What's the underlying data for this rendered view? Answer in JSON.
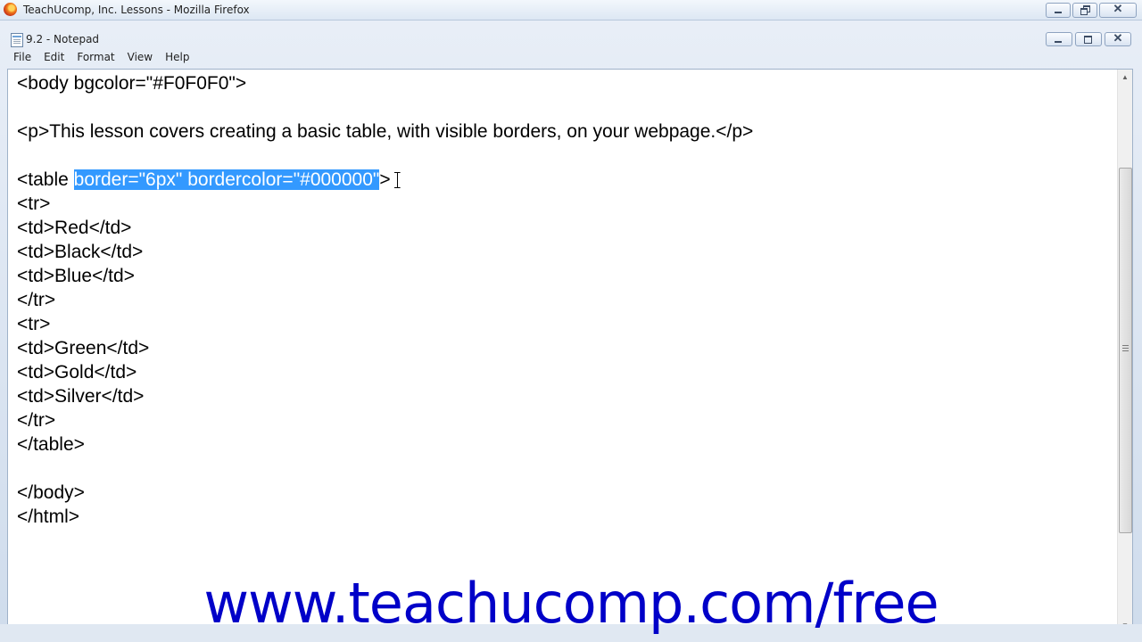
{
  "browser": {
    "title": "TeachUcomp, Inc. Lessons - Mozilla Firefox",
    "icon": "firefox-icon"
  },
  "notepad": {
    "title": "9.2 - Notepad",
    "icon": "notepad-icon",
    "menu": [
      "File",
      "Edit",
      "Format",
      "View",
      "Help"
    ],
    "lines": {
      "l1": "<body bgcolor=\"#F0F0F0\">",
      "l2": "",
      "l3": "<p>This lesson covers creating a basic table, with visible borders, on your webpage.</p>",
      "l4": "",
      "l5_before": "<table ",
      "l5_selected": "border=\"6px\" bordercolor=\"#000000\"",
      "l5_after": ">",
      "l6": "<tr>",
      "l7": "<td>Red</td>",
      "l8": "<td>Black</td>",
      "l9": "<td>Blue</td>",
      "l10": "</tr>",
      "l11": "<tr>",
      "l12": "<td>Green</td>",
      "l13": "<td>Gold</td>",
      "l14": "<td>Silver</td>",
      "l15": "</tr>",
      "l16": "</table>",
      "l17": "",
      "l18": "</body>",
      "l19": "</html>"
    }
  },
  "watermark": "www.teachucomp.com/free",
  "colors": {
    "selection": "#3399ff",
    "watermark": "#0000c8"
  }
}
